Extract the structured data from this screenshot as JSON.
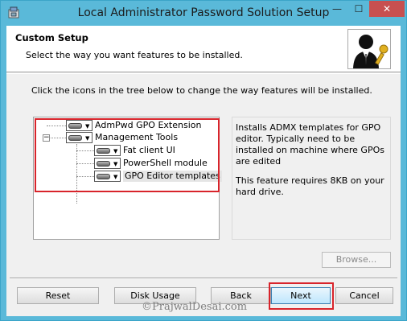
{
  "window": {
    "title": "Local Administrator Password Solution Setup"
  },
  "titlebar": {
    "minimize": "—",
    "maximize": "☐",
    "close": "✕"
  },
  "header": {
    "title": "Custom Setup",
    "subtitle": "Select the way you want features to be installed."
  },
  "instruction": "Click the icons in the tree below to change the way features will be installed.",
  "tree": {
    "items": [
      {
        "label": "AdmPwd GPO Extension"
      },
      {
        "label": "Management Tools"
      },
      {
        "label": "Fat client UI"
      },
      {
        "label": "PowerShell module"
      },
      {
        "label": "GPO Editor templates"
      }
    ]
  },
  "description": {
    "text": "Installs ADMX templates for GPO editor. Typically need to be installed on machine where GPOs are edited",
    "size_text": "This feature requires 8KB on your hard drive."
  },
  "buttons": {
    "browse": "Browse...",
    "reset": "Reset",
    "disk_usage": "Disk Usage",
    "back": "Back",
    "next": "Next",
    "cancel": "Cancel"
  },
  "watermark": "©PrajwalDesai.com",
  "colors": {
    "titlebar": "#5ab9d9",
    "close": "#c75050",
    "highlight_box": "#d8242b"
  }
}
